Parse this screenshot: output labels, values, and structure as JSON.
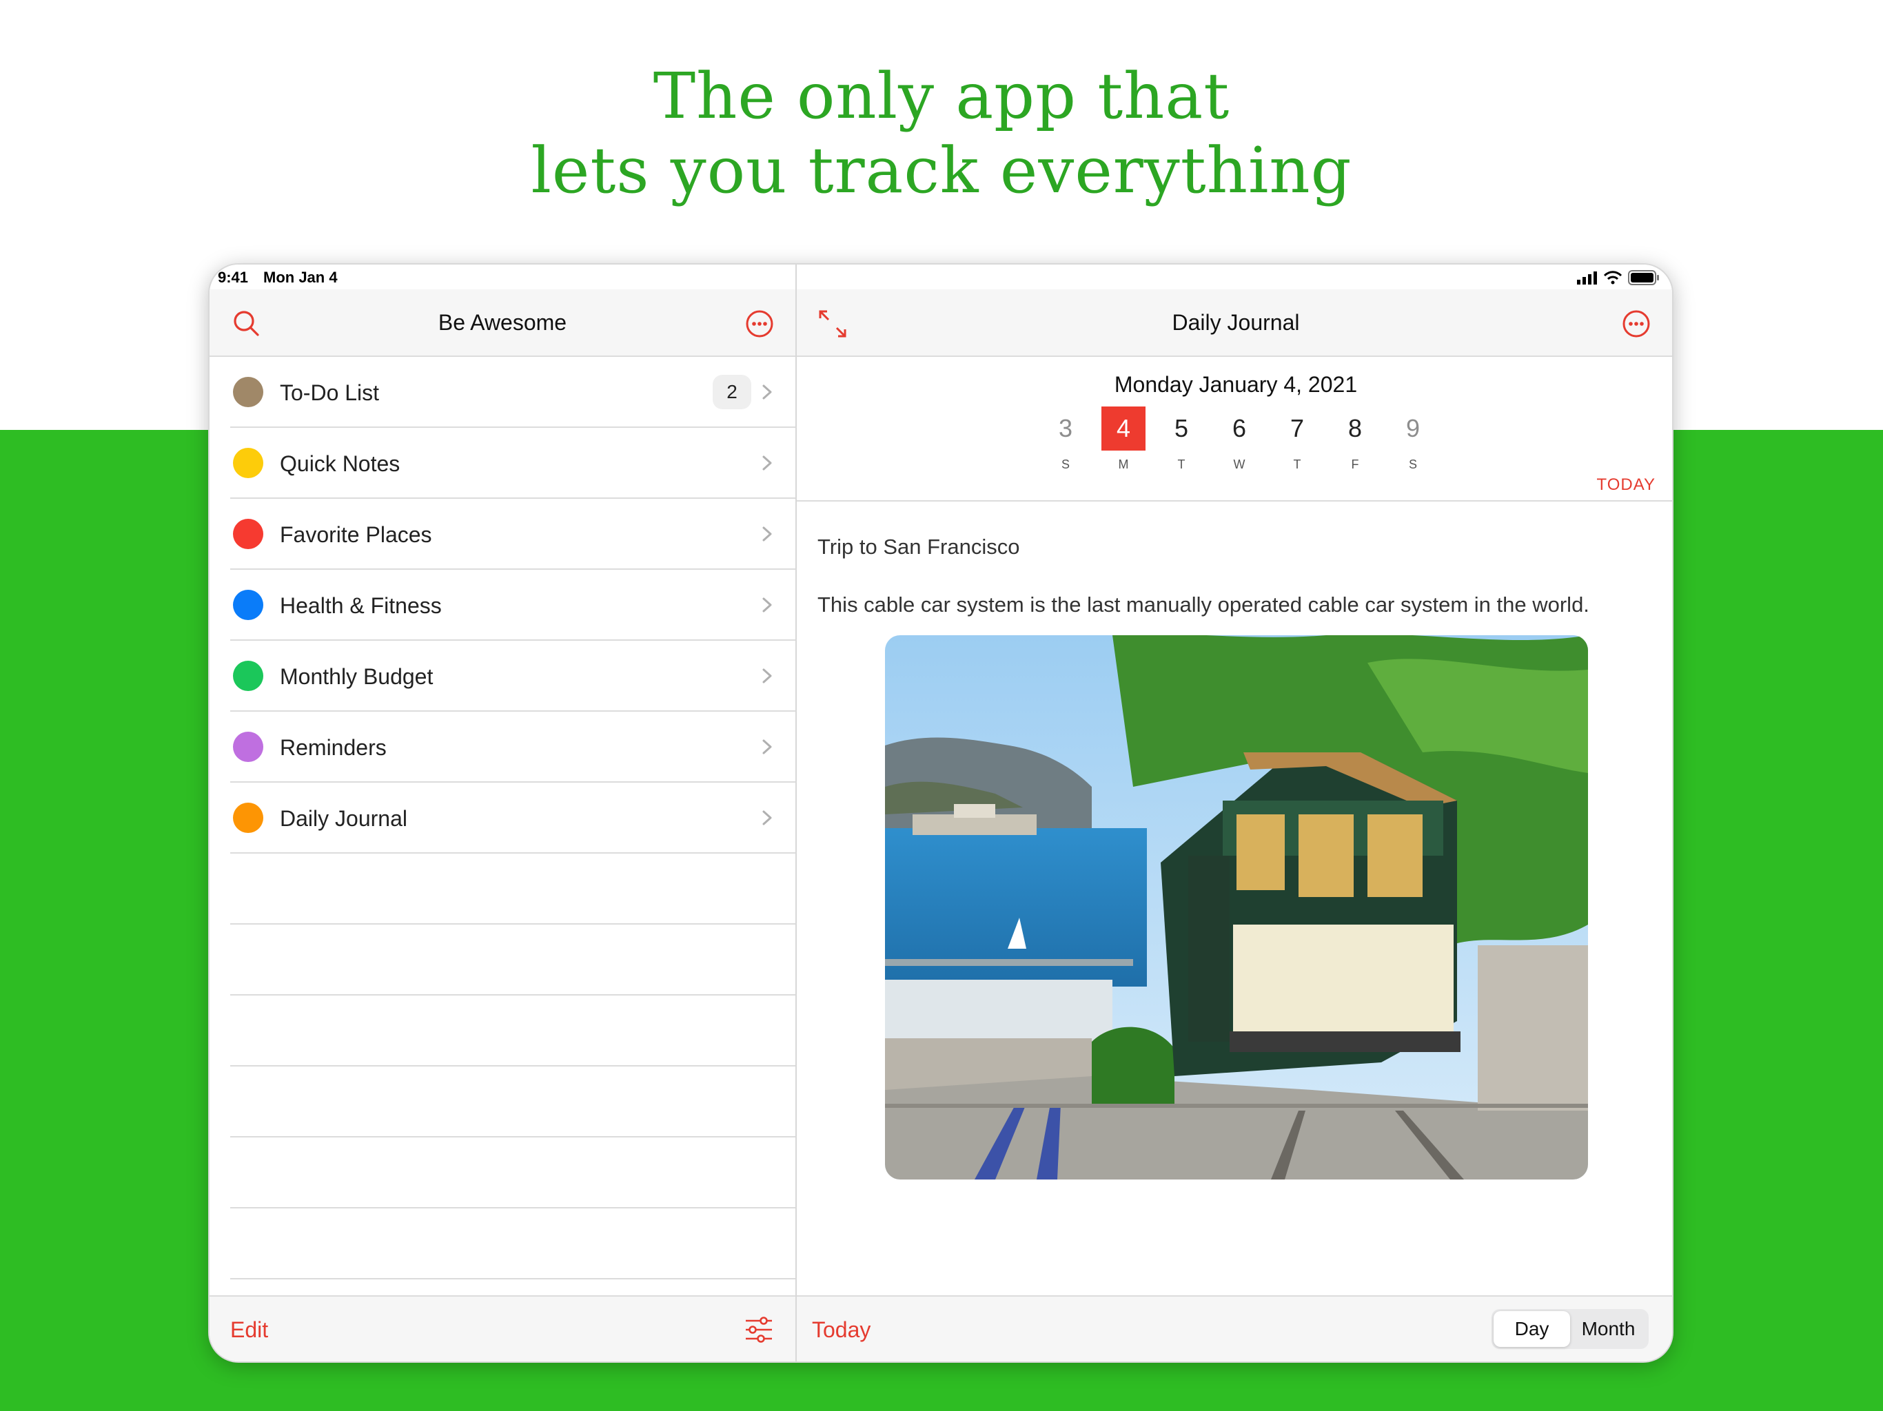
{
  "headline": {
    "line1": "The only app that",
    "line2": "lets you track everything"
  },
  "status": {
    "time": "9:41",
    "date": "Mon Jan 4"
  },
  "left": {
    "title": "Be Awesome",
    "items": [
      {
        "label": "To-Do List",
        "color": "#a08868",
        "badge": "2"
      },
      {
        "label": "Quick Notes",
        "color": "#fdcc0a"
      },
      {
        "label": "Favorite Places",
        "color": "#f63a30"
      },
      {
        "label": "Health & Fitness",
        "color": "#0a7cf9"
      },
      {
        "label": "Monthly Budget",
        "color": "#1bc75a"
      },
      {
        "label": "Reminders",
        "color": "#bf6fe0"
      },
      {
        "label": "Daily Journal",
        "color": "#fd9504"
      }
    ],
    "edit_label": "Edit"
  },
  "right": {
    "title": "Daily Journal",
    "date_title": "Monday  January 4, 2021",
    "days": [
      {
        "num": "3",
        "letter": "S"
      },
      {
        "num": "4",
        "letter": "M"
      },
      {
        "num": "5",
        "letter": "T"
      },
      {
        "num": "6",
        "letter": "W"
      },
      {
        "num": "7",
        "letter": "T"
      },
      {
        "num": "8",
        "letter": "F"
      },
      {
        "num": "9",
        "letter": "S"
      }
    ],
    "today_link": "TODAY",
    "entry_title": "Trip to San Francisco",
    "entry_body": "This cable car system is the last manually operated cable car system in the world.",
    "today_button": "Today",
    "view_day": "Day",
    "view_month": "Month"
  },
  "colors": {
    "accent": "#e53b2f",
    "green": "#2ebd23",
    "headline": "#2ca623"
  }
}
